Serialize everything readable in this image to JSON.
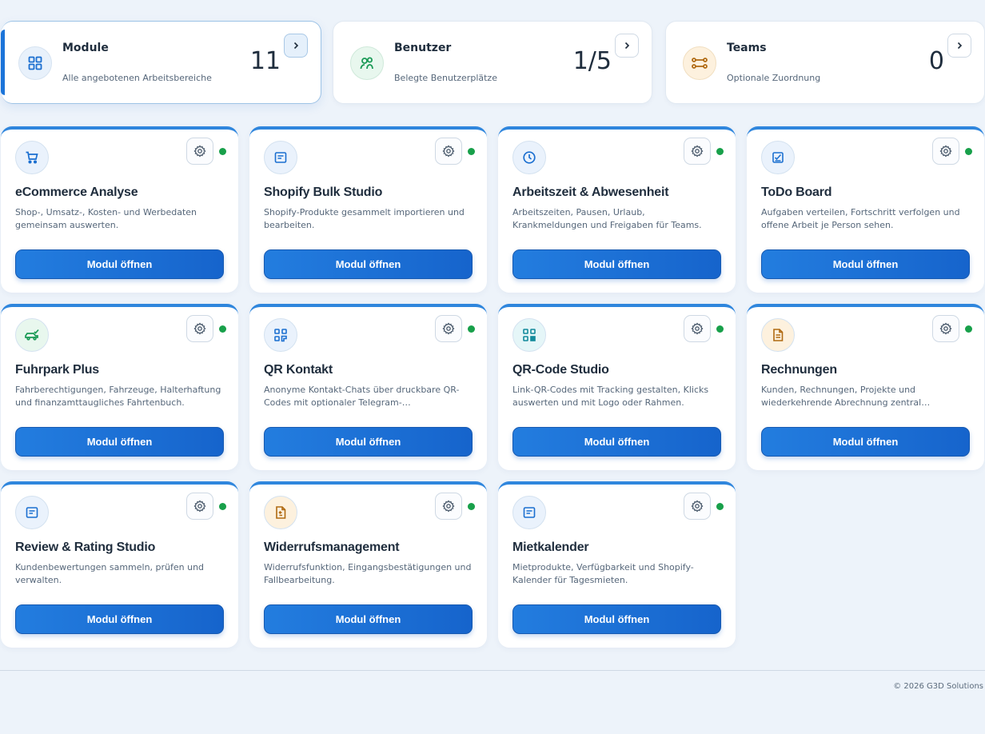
{
  "stats": [
    {
      "title": "Module",
      "subtitle": "Alle angebotenen Arbeitsbereiche",
      "value": "11",
      "icon": "grid-icon",
      "color": "#1b6fd0",
      "bg": "#e8f1fb"
    },
    {
      "title": "Benutzer",
      "subtitle": "Belegte Benutzerplätze",
      "value": "1/5",
      "icon": "users-icon",
      "color": "#1a9a56",
      "bg": "#e8f7ee"
    },
    {
      "title": "Teams",
      "subtitle": "Optionale Zuordnung",
      "value": "0",
      "icon": "teams-icon",
      "color": "#b06a12",
      "bg": "#fdf1de"
    }
  ],
  "modules": [
    {
      "title": "eCommerce Analyse",
      "description": "Shop-, Umsatz-, Kosten- und Werbedaten gemeinsam auswerten.",
      "icon": "cart-icon",
      "color": "#1b6fd0",
      "bg": "#eaf2fc"
    },
    {
      "title": "Shopify Bulk Studio",
      "description": "Shopify-Produkte gesammelt importieren und bearbeiten.",
      "icon": "document-icon",
      "color": "#1b6fd0",
      "bg": "#eaf2fc"
    },
    {
      "title": "Arbeitszeit & Abwesenheit",
      "description": "Arbeitszeiten, Pausen, Urlaub, Krankmeldungen und Freigaben für Teams.",
      "icon": "clock-icon",
      "color": "#1b6fd0",
      "bg": "#eaf2fc"
    },
    {
      "title": "ToDo Board",
      "description": "Aufgaben verteilen, Fortschritt verfolgen und offene Arbeit je Person sehen.",
      "icon": "checklist-icon",
      "color": "#1b6fd0",
      "bg": "#eaf2fc"
    },
    {
      "title": "Fuhrpark Plus",
      "description": "Fahrberechtigungen, Fahrzeuge, Halterhaftung und finanzamttaugliches Fahrtenbuch.",
      "icon": "car-icon",
      "color": "#1a9a56",
      "bg": "#e8f7ee"
    },
    {
      "title": "QR Kontakt",
      "description": "Anonyme Kontakt-Chats über druckbare QR-Codes mit optionaler Telegram-…",
      "icon": "qr-contact-icon",
      "color": "#1b6fd0",
      "bg": "#eaf2fc"
    },
    {
      "title": "QR-Code Studio",
      "description": "Link-QR-Codes mit Tracking gestalten, Klicks auswerten und mit Logo oder Rahmen.",
      "icon": "qr-code-icon",
      "color": "#138a9c",
      "bg": "#e5f6f8"
    },
    {
      "title": "Rechnungen",
      "description": "Kunden, Rechnungen, Projekte und wiederkehrende Abrechnung zentral…",
      "icon": "invoice-icon",
      "color": "#b06a12",
      "bg": "#fdf1de"
    },
    {
      "title": "Review & Rating Studio",
      "description": "Kundenbewertungen sammeln, prüfen und verwalten.",
      "icon": "document-icon",
      "color": "#1b6fd0",
      "bg": "#eaf2fc"
    },
    {
      "title": "Widerrufsmanagement",
      "description": "Widerrufsfunktion, Eingangsbestätigungen und Fallbearbeitung.",
      "icon": "return-document-icon",
      "color": "#b06a12",
      "bg": "#fdf1de"
    },
    {
      "title": "Mietkalender",
      "description": "Mietprodukte, Verfügbarkeit und Shopify-Kalender für Tagesmieten.",
      "icon": "document-icon",
      "color": "#1b6fd0",
      "bg": "#eaf2fc"
    }
  ],
  "open_label": "Modul öffnen",
  "status_color": "#18a04a",
  "footer": "© 2026 G3D Solutions"
}
